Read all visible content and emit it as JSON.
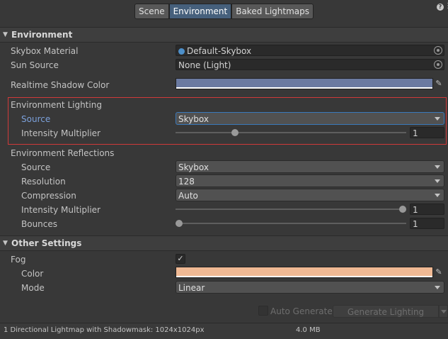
{
  "tabs": [
    {
      "label": "Scene",
      "active": false
    },
    {
      "label": "Environment",
      "active": true
    },
    {
      "label": "Baked Lightmaps",
      "active": false
    }
  ],
  "icons": {
    "help": "help-icon",
    "menu": "kebab-menu-icon",
    "picker": "object-picker-icon",
    "eyedropper": "eyedropper-icon"
  },
  "environment": {
    "header": "Environment",
    "skybox_material": {
      "label": "Skybox Material",
      "value": "Default-Skybox"
    },
    "sun_source": {
      "label": "Sun Source",
      "value": "None (Light)"
    },
    "realtime_shadow_color": {
      "label": "Realtime Shadow Color",
      "color": "#6b7aa1"
    },
    "lighting": {
      "header": "Environment Lighting",
      "source": {
        "label": "Source",
        "value": "Skybox"
      },
      "intensity": {
        "label": "Intensity Multiplier",
        "value": "1",
        "level": 0.25
      }
    },
    "reflections": {
      "header": "Environment Reflections",
      "source": {
        "label": "Source",
        "value": "Skybox"
      },
      "resolution": {
        "label": "Resolution",
        "value": "128"
      },
      "compression": {
        "label": "Compression",
        "value": "Auto"
      },
      "intensity": {
        "label": "Intensity Multiplier",
        "value": "1",
        "level": 1.0
      },
      "bounces": {
        "label": "Bounces",
        "value": "1",
        "level": 0.0
      }
    }
  },
  "other_settings": {
    "header": "Other Settings",
    "fog": {
      "label": "Fog",
      "checked": true
    },
    "fog_color": {
      "label": "Color",
      "color": "#f0b994"
    },
    "fog_mode": {
      "label": "Mode",
      "value": "Linear"
    }
  },
  "footer": {
    "auto_generate": "Auto Generate",
    "generate_lighting": "Generate Lighting",
    "status_text": "1 Directional Lightmap with Shadowmask: 1024x1024px",
    "size_text": "4.0 MB"
  }
}
